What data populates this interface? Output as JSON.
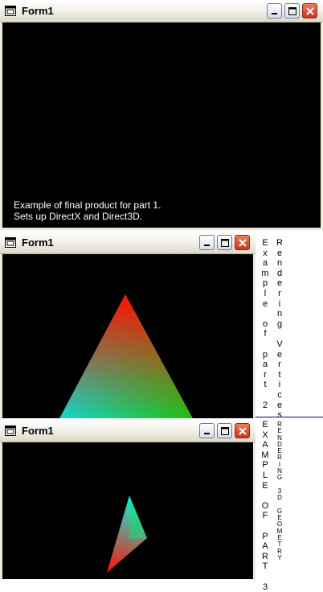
{
  "windows": [
    {
      "title": "Form1",
      "caption_lines": [
        "Example of final product for part 1.",
        "Sets up DirectX and Direct3D."
      ]
    },
    {
      "title": "Form1"
    },
    {
      "title": "Form1"
    }
  ],
  "side_labels": {
    "part2_left": "Example of part 2",
    "part2_right": "Rendering Vertices",
    "part3_left": "EXAMPLE OF PART 3",
    "part3_right": "RENDERING 3D GEOMETRY"
  },
  "colors": {
    "client_bg": "#000000",
    "triangle_top": "#ff0000",
    "triangle_left": "#00e0e0",
    "triangle_right": "#00c000",
    "divider": "#000080"
  },
  "icons": [
    "window-icon",
    "minimize-icon",
    "maximize-icon",
    "close-icon"
  ]
}
